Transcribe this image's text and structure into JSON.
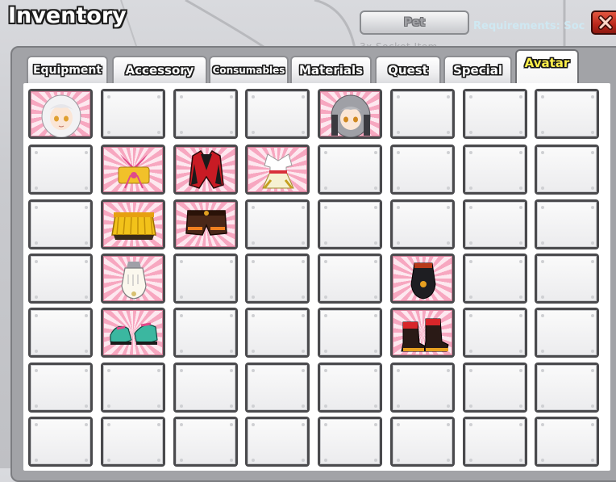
{
  "window": {
    "title": "Inventory",
    "pet_button_label": "Pet",
    "requirements_text": "Requirements: Soc",
    "ghost_text": "3x Socket Item"
  },
  "tabs": [
    {
      "label": "Equipment",
      "active": false
    },
    {
      "label": "Accessory",
      "active": false
    },
    {
      "label": "Consumables",
      "active": false
    },
    {
      "label": "Materials",
      "active": false
    },
    {
      "label": "Quest",
      "active": false
    },
    {
      "label": "Special",
      "active": false
    },
    {
      "label": "Avatar",
      "active": true
    }
  ],
  "grid": {
    "rows": 7,
    "cols": 8,
    "items": [
      {
        "row": 0,
        "col": 0,
        "icon": "white-hair-head-icon"
      },
      {
        "row": 0,
        "col": 4,
        "icon": "gray-hair-head-icon"
      },
      {
        "row": 1,
        "col": 1,
        "icon": "bow-top-icon"
      },
      {
        "row": 1,
        "col": 2,
        "icon": "red-jacket-icon"
      },
      {
        "row": 1,
        "col": 3,
        "icon": "white-dress-icon"
      },
      {
        "row": 2,
        "col": 1,
        "icon": "yellow-skirt-icon"
      },
      {
        "row": 2,
        "col": 2,
        "icon": "brown-shorts-icon"
      },
      {
        "row": 3,
        "col": 1,
        "icon": "white-glove-icon"
      },
      {
        "row": 3,
        "col": 5,
        "icon": "black-glove-icon"
      },
      {
        "row": 4,
        "col": 1,
        "icon": "teal-shoes-icon"
      },
      {
        "row": 4,
        "col": 5,
        "icon": "red-boots-icon"
      }
    ]
  },
  "colors": {
    "active_tab_text": "#fff04a",
    "slot_frame": "#4a4a4d",
    "filled_slot_pink": "#f7a7c0",
    "close_button": "#b8261a"
  }
}
